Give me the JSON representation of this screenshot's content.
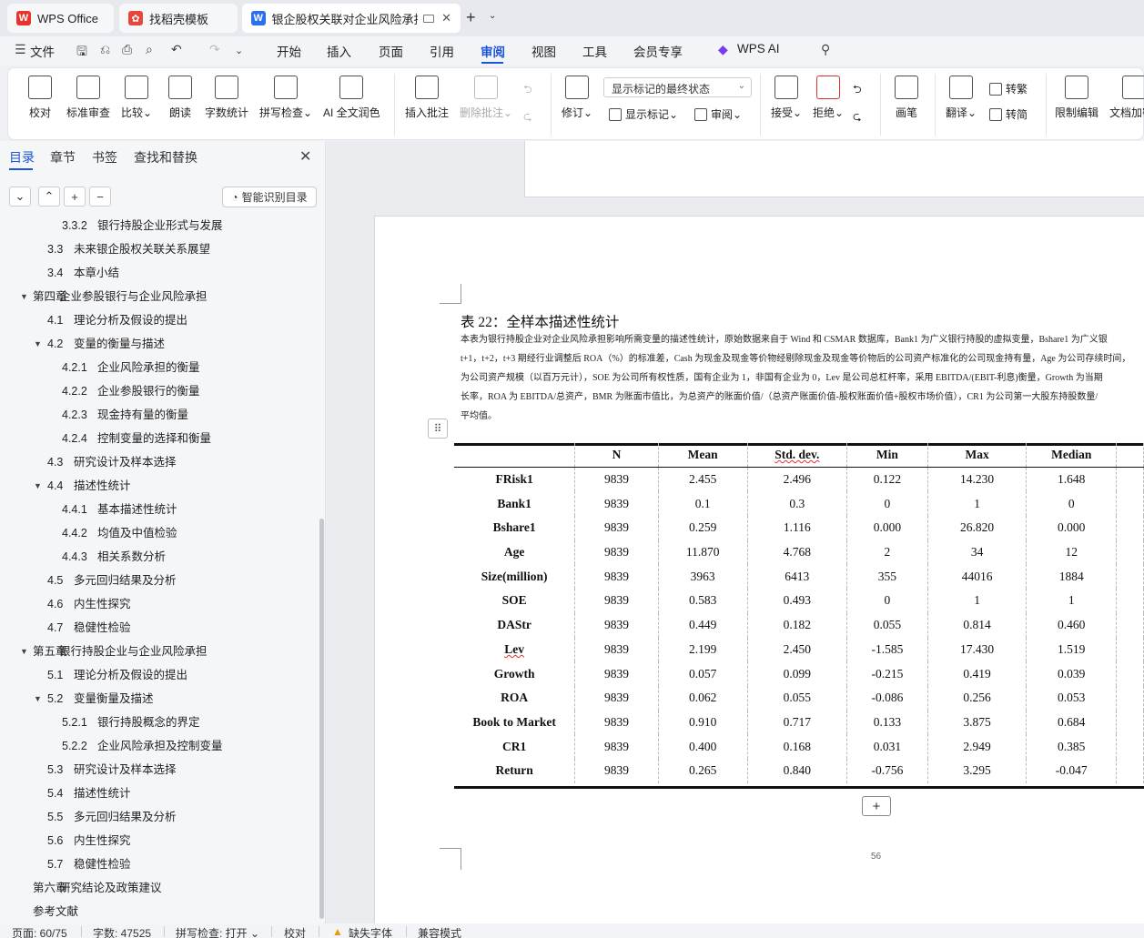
{
  "tabs": [
    {
      "label": "WPS Office",
      "icon": "wps-logo-icon"
    },
    {
      "label": "找稻壳模板",
      "icon": "docer-icon"
    },
    {
      "label": "银企股权关联对企业风险承担影",
      "icon": "word-doc-icon"
    }
  ],
  "menu": [
    "文件",
    "开始",
    "插入",
    "页面",
    "引用",
    "审阅",
    "视图",
    "工具",
    "会员专享",
    "WPS AI"
  ],
  "active_menu": "审阅",
  "ribbon": {
    "buttons": [
      "校对",
      "标准审查",
      "比较",
      "朗读",
      "字数统计",
      "拼写检查",
      "AI 全文润色",
      "插入批注",
      "删除批注",
      "修订",
      "画笔",
      "翻译",
      "限制编辑",
      "文档加密"
    ],
    "small": [
      "显示标记",
      "审阅",
      "接受",
      "拒绝",
      "转繁",
      "转简"
    ],
    "display_select": "显示标记的最终状态"
  },
  "sidebar": {
    "tabs": [
      "目录",
      "章节",
      "书签",
      "查找和替换"
    ],
    "smart_button": "智能识别目录",
    "toc": [
      {
        "num": "3.3.2",
        "text": "银行持股企业形式与发展",
        "level": 3
      },
      {
        "num": "3.3",
        "text": "未来银企股权关联关系展望",
        "level": 2
      },
      {
        "num": "3.4",
        "text": "本章小结",
        "level": 2
      },
      {
        "num": "第四章",
        "text": "企业参股银行与企业风险承担",
        "level": 1,
        "expanded": true
      },
      {
        "num": "4.1",
        "text": "理论分析及假设的提出",
        "level": 2
      },
      {
        "num": "4.2",
        "text": "变量的衡量与描述",
        "level": 2,
        "expanded": true
      },
      {
        "num": "4.2.1",
        "text": "企业风险承担的衡量",
        "level": 3
      },
      {
        "num": "4.2.2",
        "text": "企业参股银行的衡量",
        "level": 3
      },
      {
        "num": "4.2.3",
        "text": "现金持有量的衡量",
        "level": 3
      },
      {
        "num": "4.2.4",
        "text": "控制变量的选择和衡量",
        "level": 3
      },
      {
        "num": "4.3",
        "text": "研究设计及样本选择",
        "level": 2
      },
      {
        "num": "4.4",
        "text": "描述性统计",
        "level": 2,
        "expanded": true
      },
      {
        "num": "4.4.1",
        "text": "基本描述性统计",
        "level": 3
      },
      {
        "num": "4.4.2",
        "text": "均值及中值检验",
        "level": 3
      },
      {
        "num": "4.4.3",
        "text": "相关系数分析",
        "level": 3
      },
      {
        "num": "4.5",
        "text": "多元回归结果及分析",
        "level": 2
      },
      {
        "num": "4.6",
        "text": "内生性探究",
        "level": 2
      },
      {
        "num": "4.7",
        "text": "稳健性检验",
        "level": 2
      },
      {
        "num": "第五章",
        "text": "银行持股企业与企业风险承担",
        "level": 1,
        "expanded": true
      },
      {
        "num": "5.1",
        "text": "理论分析及假设的提出",
        "level": 2
      },
      {
        "num": "5.2",
        "text": "变量衡量及描述",
        "level": 2,
        "expanded": true
      },
      {
        "num": "5.2.1",
        "text": "银行持股概念的界定",
        "level": 3
      },
      {
        "num": "5.2.2",
        "text": "企业风险承担及控制变量",
        "level": 3
      },
      {
        "num": "5.3",
        "text": "研究设计及样本选择",
        "level": 2
      },
      {
        "num": "5.4",
        "text": "描述性统计",
        "level": 2
      },
      {
        "num": "5.5",
        "text": "多元回归结果及分析",
        "level": 2
      },
      {
        "num": "5.6",
        "text": "内生性探究",
        "level": 2
      },
      {
        "num": "5.7",
        "text": "稳健性检验",
        "level": 2
      },
      {
        "num": "第六章",
        "text": "研究结论及政策建议",
        "level": 1
      },
      {
        "num": "",
        "text": "参考文献",
        "level": 1
      }
    ]
  },
  "document": {
    "table_title": "表 22：全样本描述性统计",
    "note_lines": [
      "本表为银行持股企业对企业风险承担影响所需变量的描述性统计，原始数据来自于 Wind 和 CSMAR 数据库，Bank1 为广义银行持股的虚拟变量，Bshare1 为广义银",
      "t+1，t+2，t+3 期经行业调整后 ROA（%）的标准差，Cash 为现金及现金等价物经剔除现金及现金等价物后的公司资产标准化的公司现金持有量，Age 为公司存续时间，",
      "为公司资产规模（以百万元计），SOE 为公司所有权性质，国有企业为 1，非国有企业为 0，Lev 是公司总杠杆率，采用 EBITDA/(EBIT-利息)衡量，Growth 为当期",
      "长率，ROA 为 EBITDA/总资产，BMR 为账面市值比，为总资产的账面价值/（总资产账面价值-股权账面价值+股权市场价值），CR1 为公司第一大股东持股数量/",
      "平均值。"
    ],
    "table": {
      "headers": [
        "",
        "N",
        "Mean",
        "Std. dev.",
        "Min",
        "Max",
        "Median"
      ],
      "rows": [
        [
          "FRisk1",
          "9839",
          "2.455",
          "2.496",
          "0.122",
          "14.230",
          "1.648"
        ],
        [
          "Bank1",
          "9839",
          "0.1",
          "0.3",
          "0",
          "1",
          "0"
        ],
        [
          "Bshare1",
          "9839",
          "0.259",
          "1.116",
          "0.000",
          "26.820",
          "0.000"
        ],
        [
          "Age",
          "9839",
          "11.870",
          "4.768",
          "2",
          "34",
          "12"
        ],
        [
          "Size(million)",
          "9839",
          "3963",
          "6413",
          "355",
          "44016",
          "1884"
        ],
        [
          "SOE",
          "9839",
          "0.583",
          "0.493",
          "0",
          "1",
          "1"
        ],
        [
          "DAStr",
          "9839",
          "0.449",
          "0.182",
          "0.055",
          "0.814",
          "0.460"
        ],
        [
          "Lev",
          "9839",
          "2.199",
          "2.450",
          "-1.585",
          "17.430",
          "1.519"
        ],
        [
          "Growth",
          "9839",
          "0.057",
          "0.099",
          "-0.215",
          "0.419",
          "0.039"
        ],
        [
          "ROA",
          "9839",
          "0.062",
          "0.055",
          "-0.086",
          "0.256",
          "0.053"
        ],
        [
          "Book to Market",
          "9839",
          "0.910",
          "0.717",
          "0.133",
          "3.875",
          "0.684"
        ],
        [
          "CR1",
          "9839",
          "0.400",
          "0.168",
          "0.031",
          "2.949",
          "0.385"
        ],
        [
          "Return",
          "9839",
          "0.265",
          "0.840",
          "-0.756",
          "3.295",
          "-0.047"
        ]
      ]
    },
    "page_number": "56"
  },
  "status": {
    "page": "页面: 60/75",
    "words": "字数: 47525",
    "spell": "拼写检查: 打开",
    "proof": "校对",
    "missing_font": "缺失字体",
    "compat": "兼容模式"
  }
}
